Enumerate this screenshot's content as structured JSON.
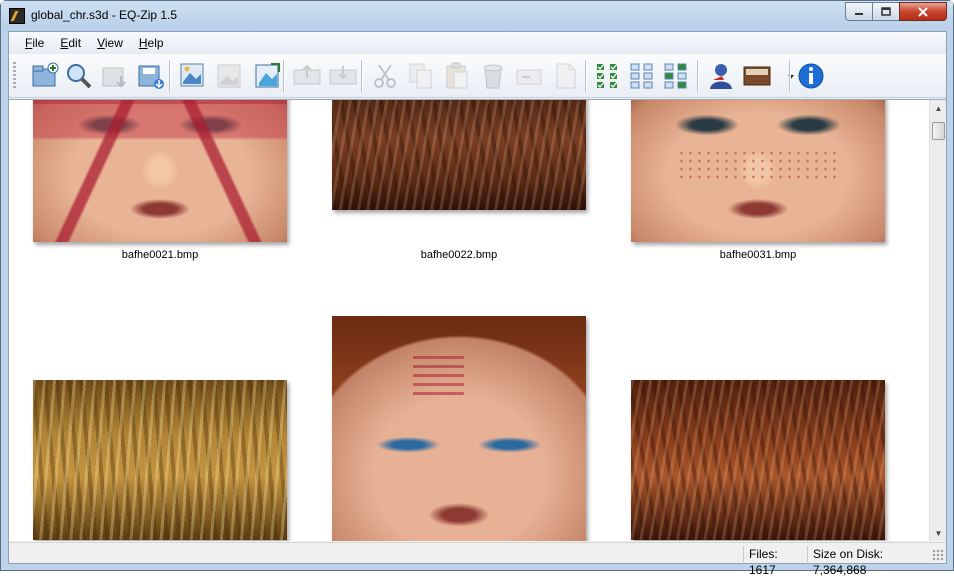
{
  "window": {
    "title": "global_chr.s3d - EQ-Zip 1.5",
    "controls": [
      "minimize-icon",
      "maximize-icon",
      "close-icon"
    ]
  },
  "menu": {
    "items": [
      {
        "label": "File",
        "accel": "F",
        "rest": "ile"
      },
      {
        "label": "Edit",
        "accel": "E",
        "rest": "dit"
      },
      {
        "label": "View",
        "accel": "V",
        "rest": "iew"
      },
      {
        "label": "Help",
        "accel": "H",
        "rest": "elp"
      }
    ]
  },
  "toolbar": {
    "buttons": [
      {
        "icon": "new-archive-icon",
        "enabled": true
      },
      {
        "icon": "open-archive-icon",
        "enabled": true
      },
      {
        "icon": "extract-icon",
        "enabled": false
      },
      {
        "icon": "save-as-icon",
        "enabled": true
      },
      {
        "icon": "import-image-icon",
        "enabled": true
      },
      {
        "icon": "replace-image-icon",
        "enabled": false
      },
      {
        "icon": "export-image-icon",
        "enabled": true
      },
      {
        "icon": "move-up-icon",
        "enabled": false
      },
      {
        "icon": "move-down-icon",
        "enabled": false
      },
      {
        "icon": "cut-icon",
        "enabled": false
      },
      {
        "icon": "copy-icon",
        "enabled": false
      },
      {
        "icon": "paste-icon",
        "enabled": false
      },
      {
        "icon": "delete-icon",
        "enabled": false
      },
      {
        "icon": "rename-icon",
        "enabled": false
      },
      {
        "icon": "properties-icon",
        "enabled": false
      },
      {
        "icon": "select-all-icon",
        "enabled": true
      },
      {
        "icon": "select-none-icon",
        "enabled": true
      },
      {
        "icon": "invert-selection-icon",
        "enabled": true
      },
      {
        "icon": "user-icon",
        "enabled": true
      },
      {
        "icon": "view-thumbnails-icon",
        "enabled": true
      },
      {
        "icon": "about-info-icon",
        "enabled": true
      }
    ]
  },
  "files": [
    {
      "name": "bafhe0021.bmp",
      "kind": "face-red-paint"
    },
    {
      "name": "bafhe0022.bmp",
      "kind": "hair-dark"
    },
    {
      "name": "bafhe0031.bmp",
      "kind": "face-freckles"
    },
    {
      "name": "",
      "kind": "hair-blonde"
    },
    {
      "name": "",
      "kind": "face-tribal"
    },
    {
      "name": "",
      "kind": "hair-auburn"
    }
  ],
  "status": {
    "files": "Files: 1617",
    "size": "Size on Disk: 7,364,868"
  }
}
